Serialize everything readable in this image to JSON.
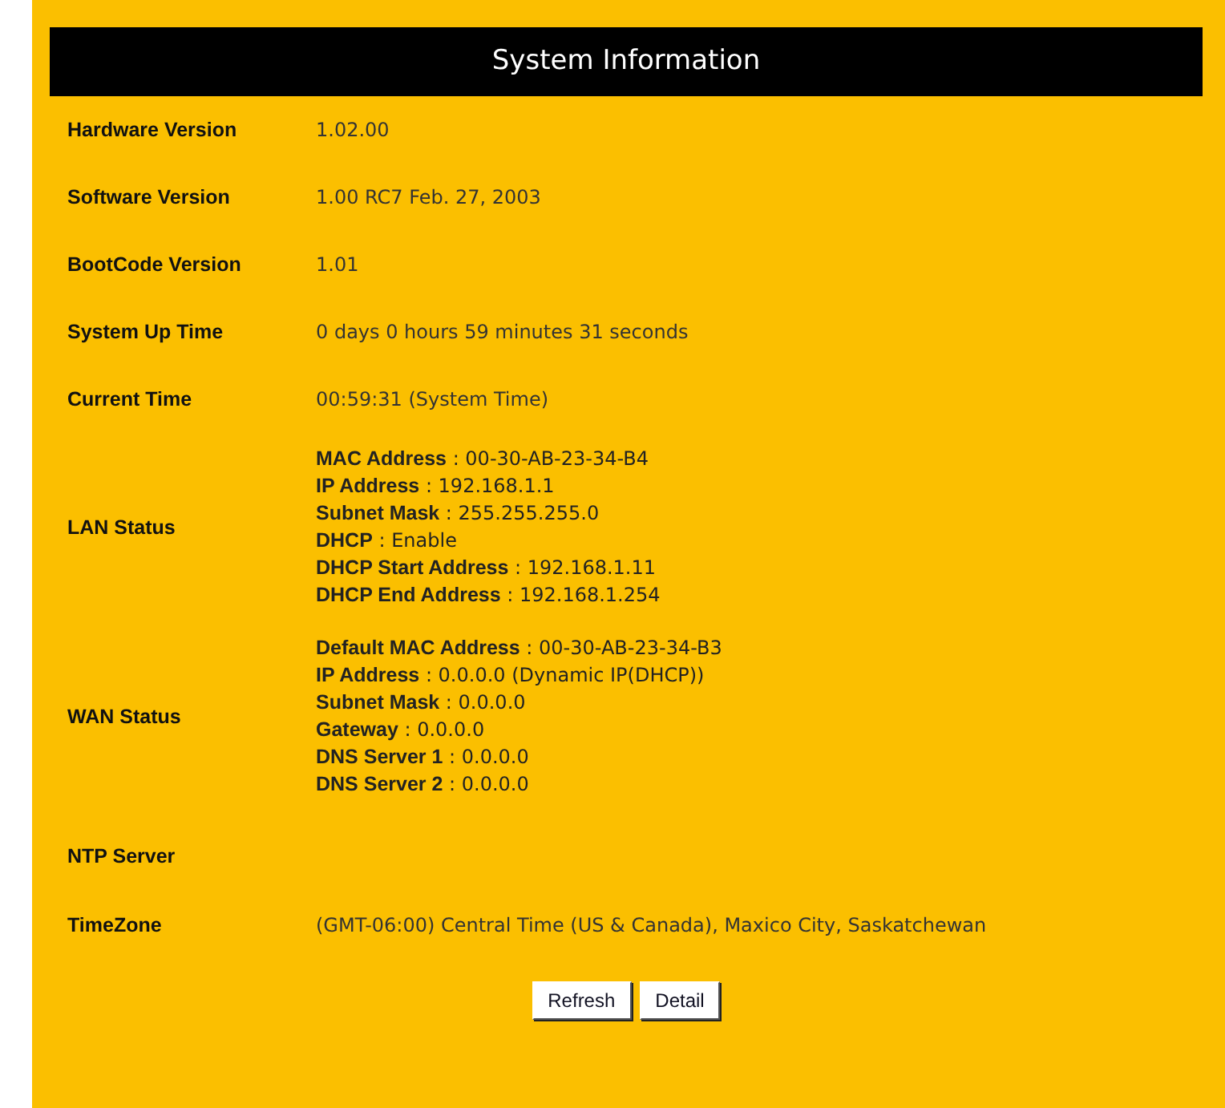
{
  "title": "System Information",
  "rows": [
    {
      "label": "Hardware Version",
      "value": "1.02.00"
    },
    {
      "label": "Software Version",
      "value": "1.00 RC7 Feb. 27, 2003"
    },
    {
      "label": "BootCode Version",
      "value": "1.01"
    },
    {
      "label": "System Up Time",
      "value": "0 days 0 hours 59 minutes 31 seconds"
    },
    {
      "label": "Current Time",
      "value": "00:59:31 (System Time)"
    },
    {
      "label": "LAN Status",
      "fields": [
        "**MAC Address** : 00-30-AB-23-34-B4",
        "**IP Address** : 192.168.1.1",
        "**Subnet Mask** : 255.255.255.0",
        "**DHCP** : Enable",
        "**DHCP Start Address** : 192.168.1.11",
        "**DHCP End Address** : 192.168.1.254"
      ]
    },
    {
      "label": "WAN Status",
      "fields": [
        "**Default MAC Address** : 00-30-AB-23-34-B3",
        "**IP Address** : 0.0.0.0 (Dynamic IP(DHCP))",
        "**Subnet Mask** : 0.0.0.0",
        "**Gateway** : 0.0.0.0",
        "**DNS Server 1** : 0.0.0.0",
        "**DNS Server 2** : 0.0.0.0"
      ]
    },
    {
      "label": "NTP Server"
    },
    {
      "label": "TimeZone",
      "value": "(GMT-06:00) Central Time (US & Canada), Maxico City, Saskatchewan"
    }
  ],
  "buttons": [
    "Refresh",
    "Detail"
  ]
}
